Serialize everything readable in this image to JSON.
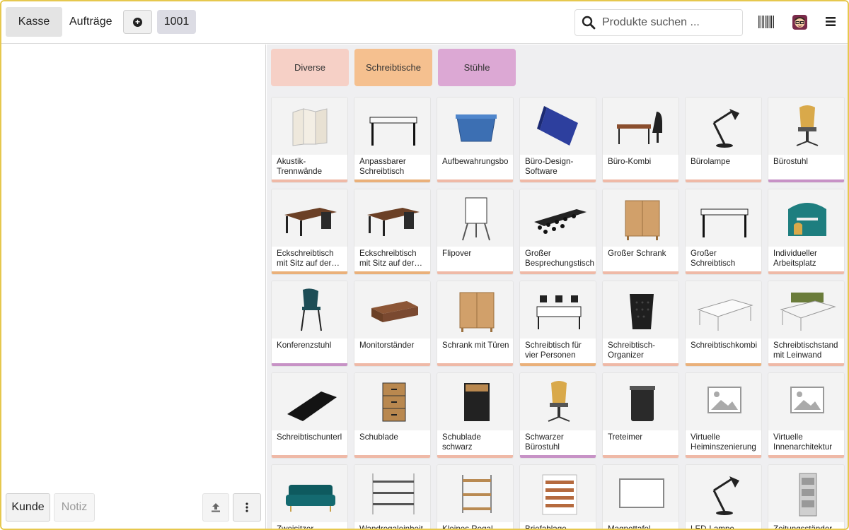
{
  "header": {
    "kasse_label": "Kasse",
    "orders_label": "Aufträge",
    "order_number": "1001",
    "search_placeholder": "Produkte suchen ..."
  },
  "left": {
    "customer_label": "Kunde",
    "note_label": "Notiz"
  },
  "categories": [
    {
      "label": "Diverse",
      "color": "#f6d0c6"
    },
    {
      "label": "Schreibtische",
      "color": "#f5c08f"
    },
    {
      "label": "Stühle",
      "color": "#dca8d4"
    }
  ],
  "colors": {
    "diverse": "#efb9a7",
    "desk": "#eab07a",
    "chair": "#c792c6"
  },
  "products": [
    {
      "name": "Akustik-Trennwände",
      "icon": "panel-icon",
      "cat": "diverse"
    },
    {
      "name": "Anpassbarer Schreibtisch",
      "icon": "desk-icon",
      "cat": "desk"
    },
    {
      "name": "Aufbewahrungsbo",
      "icon": "box-icon",
      "cat": "diverse"
    },
    {
      "name": "Büro-Design-Software",
      "icon": "software-box-icon",
      "cat": "diverse"
    },
    {
      "name": "Büro-Kombi",
      "icon": "desk-chair-icon",
      "cat": "diverse"
    },
    {
      "name": "Bürolampe",
      "icon": "lamp-icon",
      "cat": "diverse"
    },
    {
      "name": "Bürostuhl",
      "icon": "office-chair-icon",
      "cat": "chair"
    },
    {
      "name": "Eckschreibtisch mit Sitz auf der…",
      "icon": "corner-desk-icon",
      "cat": "desk"
    },
    {
      "name": "Eckschreibtisch mit Sitz auf der…",
      "icon": "corner-desk-icon",
      "cat": "desk"
    },
    {
      "name": "Flipover",
      "icon": "flipchart-icon",
      "cat": "diverse"
    },
    {
      "name": "Großer Besprechungstisch",
      "icon": "meeting-table-icon",
      "cat": "diverse"
    },
    {
      "name": "Großer Schrank",
      "icon": "cabinet-icon",
      "cat": "diverse"
    },
    {
      "name": "Großer Schreibtisch",
      "icon": "desk-icon",
      "cat": "diverse"
    },
    {
      "name": "Individueller Arbeitsplatz",
      "icon": "pod-icon",
      "cat": "diverse"
    },
    {
      "name": "Konferenzstuhl",
      "icon": "chair-icon",
      "cat": "chair"
    },
    {
      "name": "Monitorständer",
      "icon": "stand-icon",
      "cat": "diverse"
    },
    {
      "name": "Schrank mit Türen",
      "icon": "cabinet-icon",
      "cat": "diverse"
    },
    {
      "name": "Schreibtisch für vier Personen",
      "icon": "quad-desk-icon",
      "cat": "desk"
    },
    {
      "name": "Schreibtisch-Organizer",
      "icon": "organizer-icon",
      "cat": "diverse"
    },
    {
      "name": "Schreibtischkombi",
      "icon": "desk-combo-icon",
      "cat": "desk"
    },
    {
      "name": "Schreibtischstand mit Leinwand",
      "icon": "desk-screen-icon",
      "cat": "diverse"
    },
    {
      "name": "Schreibtischunterl",
      "icon": "mat-icon",
      "cat": "diverse"
    },
    {
      "name": "Schublade",
      "icon": "drawer-icon",
      "cat": "diverse"
    },
    {
      "name": "Schublade schwarz",
      "icon": "drawer-black-icon",
      "cat": "diverse"
    },
    {
      "name": "Schwarzer Bürostuhl",
      "icon": "office-chair-icon",
      "cat": "chair"
    },
    {
      "name": "Treteimer",
      "icon": "bin-icon",
      "cat": "diverse"
    },
    {
      "name": "Virtuelle Heiminszenierung",
      "icon": "image-placeholder-icon",
      "cat": "diverse"
    },
    {
      "name": "Virtuelle Innenarchitektur",
      "icon": "image-placeholder-icon",
      "cat": "diverse"
    },
    {
      "name": "Zweisitzer",
      "icon": "sofa-icon",
      "cat": "diverse"
    },
    {
      "name": "Wandregaleinheit",
      "icon": "shelf-icon",
      "cat": "diverse"
    },
    {
      "name": "Kleines Regal",
      "icon": "small-shelf-icon",
      "cat": "diverse"
    },
    {
      "name": "Briefablage",
      "icon": "letter-tray-icon",
      "cat": "diverse"
    },
    {
      "name": "Magnettafel",
      "icon": "whiteboard-icon",
      "cat": "diverse"
    },
    {
      "name": "LED-Lampe",
      "icon": "lamp-icon",
      "cat": "diverse"
    },
    {
      "name": "Zeitungsständer",
      "icon": "magazine-rack-icon",
      "cat": "diverse"
    }
  ]
}
